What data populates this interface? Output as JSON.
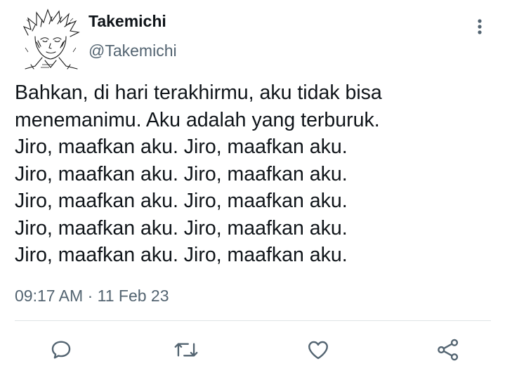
{
  "tweet": {
    "display_name": "Takemichi",
    "handle": "@Takemichi",
    "lines": [
      "Bahkan, di hari terakhirmu, aku tidak bisa",
      "menemanimu. Aku adalah yang terburuk.",
      "Jiro, maafkan aku. Jiro, maafkan aku.",
      "Jiro, maafkan aku. Jiro, maafkan aku.",
      "Jiro, maafkan aku. Jiro, maafkan aku.",
      "Jiro, maafkan aku. Jiro, maafkan aku.",
      "Jiro, maafkan aku. Jiro, maafkan aku."
    ],
    "time": "09:17 AM",
    "separator": "·",
    "date": "11 Feb 23"
  },
  "icons": {
    "more": "more-vertical-icon",
    "reply": "reply-icon",
    "retweet": "retweet-icon",
    "like": "heart-icon",
    "share": "share-icon"
  },
  "colors": {
    "text_primary": "#0f1419",
    "text_secondary": "#536471",
    "icon": "#536471",
    "divider": "#dfe3e6"
  }
}
